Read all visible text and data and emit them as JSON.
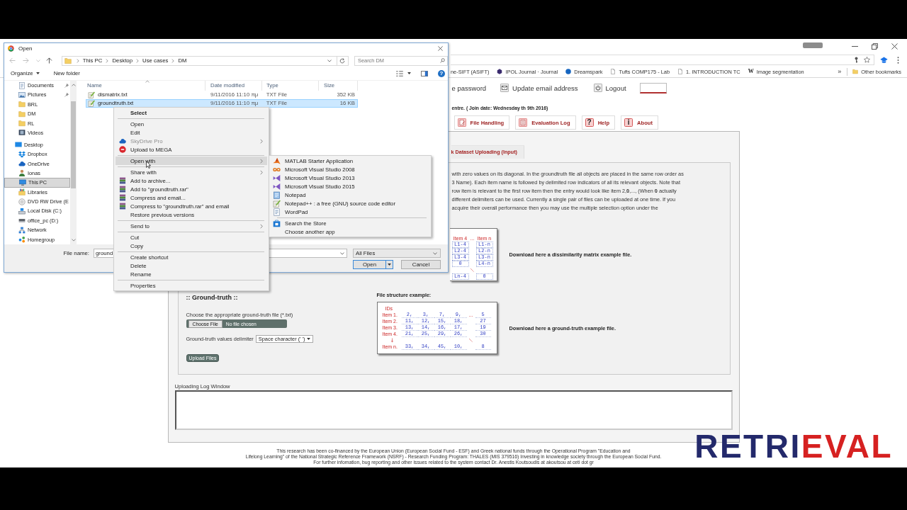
{
  "browser": {
    "bookmarks": [
      {
        "kind": "plain",
        "label": "ne-SIFT (ASIFT)"
      },
      {
        "kind": "hexagon",
        "label": "IPOL Journal · Journal"
      },
      {
        "kind": "disc",
        "label": "Dreamspark"
      },
      {
        "kind": "page",
        "label": "Tufts COMP175 - Lab"
      },
      {
        "kind": "page",
        "label": "1. INTRODUCTION TC"
      },
      {
        "kind": "glyph",
        "glyph": "W",
        "label": "Image segmentation"
      }
    ],
    "more": "»",
    "other_bookmarks": "Other bookmarks"
  },
  "page": {
    "nav": [
      {
        "kind": "plain",
        "label": "e password"
      },
      {
        "kind": "mail",
        "label": "Update email address"
      },
      {
        "kind": "power",
        "label": "Logout"
      }
    ],
    "join_info": "entre. ( Join date: Wednesday th 9th 2016)",
    "tabs": [
      {
        "kind": "file",
        "label": "File Handling"
      },
      {
        "kind": "log",
        "label": "Evaluation Log"
      },
      {
        "kind": "help",
        "glyph": "?",
        "label": "Help"
      },
      {
        "kind": "info",
        "glyph": "i",
        "label": "About"
      }
    ],
    "subtab": "k Dataset Uploading (Input)",
    "description_lines": [
      "with zero values on its diagonal. In the groundtruth file all objects are placed in the same row order as",
      "3 Name). Each item name is followed by delimited row indicators of all its relevant objects. Note that",
      "row item is relevant to the first row item then the entry would look like item 2,**0**,..., (When **0** actually",
      "different delimiters can be used. Currently a single pair of files can be uploaded at one time. If you",
      "acquire their overall performance then you may use the multiple selection option under the"
    ],
    "dissimilarity": {
      "figure": {
        "header": [
          "Item 4",
          "...",
          "Item n"
        ],
        "rows": [
          [
            "L1-4",
            "L1-n"
          ],
          [
            "L2-4",
            "L2-n"
          ],
          [
            "L3-4",
            "L3-n"
          ],
          [
            "0",
            "L4-n"
          ],
          [
            "Ln-4",
            "0"
          ]
        ]
      },
      "download_text": "Download here a dissimilarity matrix example file."
    },
    "ground_truth": {
      "heading": ":: Ground-truth ::",
      "file_label": "Choose the appropriate ground-truth file (*.txt)",
      "choose_button": "Choose File",
      "file_status": "No file chosen",
      "delimiter_label": "Ground-truth values delimiter",
      "delimiter_value": "Space character (' ')",
      "upload_button": "Upload Files",
      "structure_label": "File structure example:",
      "figure": {
        "ids_label": "IDs",
        "rows": [
          {
            "label": "Item 1.",
            "values": [
              "2,",
              "3,",
              "7,",
              "9,"
            ],
            "gap": "...",
            "last": "5"
          },
          {
            "label": "Item 2.",
            "values": [
              "11,",
              "12,",
              "15,",
              "18,"
            ],
            "last": "27"
          },
          {
            "label": "Item 3.",
            "values": [
              "13,",
              "14,",
              "16,",
              "17,"
            ],
            "last": "19"
          },
          {
            "label": "Item 4.",
            "values": [
              "21,",
              "25,",
              "29,",
              "26,"
            ],
            "last": "30"
          },
          {
            "label": "Item n.",
            "values": [
              "33,",
              "34,",
              "45,",
              "10,"
            ],
            "last": "8"
          }
        ]
      },
      "download_text": "Download here a ground-truth example file."
    },
    "log_label": "Uploading Log Window",
    "footer_lines": [
      "This research has been co-financed by the European Union (European Social Fund - ESF) and Greek national funds through the Operational Program \"Education and",
      "Lifelong Learning\" of the National Strategic Reference Framework (NSRF) - Research Funding Program: THALES (MIS 379516) Investing in knowledge society through the European Social Fund.",
      "For further infomation, bug reporting and other issues related to the system contact Dr. Anestis Koutsoudis at akoutsou at ceti dot gr"
    ],
    "logo": [
      "RETRI",
      "EVAL"
    ]
  },
  "dialog": {
    "title": "Open",
    "path": [
      "This PC",
      "Desktop",
      "Use cases",
      "DM"
    ],
    "search_placeholder": "Search DM",
    "organize": "Organize",
    "new_folder": "New folder",
    "help_glyph": "?",
    "quick_access": [
      {
        "label": "Documents",
        "kind": "document",
        "pinned": true,
        "selected": false
      },
      {
        "label": "Pictures",
        "kind": "pictures",
        "pinned": true,
        "selected": false
      },
      {
        "label": "BRL",
        "kind": "folder",
        "pinned": false,
        "selected": false
      },
      {
        "label": "DM",
        "kind": "folder",
        "pinned": false,
        "selected": false
      },
      {
        "label": "RL",
        "kind": "folder",
        "pinned": false,
        "selected": false
      },
      {
        "label": "Videos",
        "kind": "video",
        "pinned": false,
        "selected": false
      }
    ],
    "tree": [
      {
        "label": "Desktop",
        "kind": "desktop",
        "selected": false,
        "children": [
          {
            "label": "Dropbox",
            "kind": "dropbox",
            "selected": false
          },
          {
            "label": "OneDrive",
            "kind": "cloud",
            "selected": false
          },
          {
            "label": "Ionas",
            "kind": "user",
            "selected": false
          },
          {
            "label": "This PC",
            "kind": "pc",
            "selected": true
          },
          {
            "label": "Libraries",
            "kind": "libraries",
            "selected": false
          },
          {
            "label": "DVD RW Drive (E",
            "kind": "dvd",
            "selected": false
          },
          {
            "label": "Local Disk (C:)",
            "kind": "disk",
            "selected": false
          },
          {
            "label": "office_pc (D:)",
            "kind": "drive",
            "selected": false
          },
          {
            "label": "Network",
            "kind": "network",
            "selected": false
          },
          {
            "label": "Homegroup",
            "kind": "homegroup",
            "selected": false
          }
        ]
      }
    ],
    "columns": [
      "Name",
      "Date modified",
      "Type",
      "Size"
    ],
    "files": [
      {
        "name": "dismatrix.txt",
        "date": "9/11/2016 11:10 πμ",
        "type": "TXT File",
        "size": "352 KB",
        "selected": false
      },
      {
        "name": "groundtruth.txt",
        "date": "9/11/2016 11:10 πμ",
        "type": "TXT File",
        "size": "16 KB",
        "selected": true
      }
    ],
    "file_name_label": "File name:",
    "file_name_value": "ground",
    "file_type": "All Files",
    "open_button": "Open",
    "cancel_button": "Cancel"
  },
  "context_menu": {
    "groups": [
      [
        {
          "label": "Select",
          "kind": "default",
          "selected": false,
          "disabled": false,
          "submenu": false
        }
      ],
      [
        {
          "label": "Open",
          "kind": "plain",
          "selected": false,
          "disabled": false,
          "submenu": false
        },
        {
          "label": "Edit",
          "kind": "plain",
          "selected": false,
          "disabled": false,
          "submenu": false
        },
        {
          "label": "SkyDrive Pro",
          "kind": "cloud",
          "selected": false,
          "disabled": true,
          "submenu": true
        },
        {
          "label": "Upload to MEGA",
          "kind": "badge",
          "selected": false,
          "disabled": false,
          "submenu": false
        }
      ],
      [
        {
          "label": "Open with",
          "kind": "plain",
          "selected": true,
          "disabled": false,
          "submenu": true
        }
      ],
      [
        {
          "label": "Share with",
          "kind": "plain",
          "selected": false,
          "disabled": false,
          "submenu": true
        },
        {
          "label": "Add to archive...",
          "kind": "archive",
          "selected": false,
          "disabled": false,
          "submenu": false
        },
        {
          "label": "Add to \"groundtruth.rar\"",
          "kind": "archive",
          "selected": false,
          "disabled": false,
          "submenu": false
        },
        {
          "label": "Compress and email...",
          "kind": "archive",
          "selected": false,
          "disabled": false,
          "submenu": false
        },
        {
          "label": "Compress to \"groundtruth.rar\" and email",
          "kind": "archive",
          "selected": false,
          "disabled": false,
          "submenu": false
        },
        {
          "label": "Restore previous versions",
          "kind": "plain",
          "selected": false,
          "disabled": false,
          "submenu": false
        }
      ],
      [
        {
          "label": "Send to",
          "kind": "plain",
          "selected": false,
          "disabled": false,
          "submenu": true
        }
      ],
      [
        {
          "label": "Cut",
          "kind": "plain",
          "selected": false,
          "disabled": false,
          "submenu": false
        },
        {
          "label": "Copy",
          "kind": "plain",
          "selected": false,
          "disabled": false,
          "submenu": false
        }
      ],
      [
        {
          "label": "Create shortcut",
          "kind": "plain",
          "selected": false,
          "disabled": false,
          "submenu": false
        },
        {
          "label": "Delete",
          "kind": "plain",
          "selected": false,
          "disabled": false,
          "submenu": false
        },
        {
          "label": "Rename",
          "kind": "plain",
          "selected": false,
          "disabled": false,
          "submenu": false
        }
      ],
      [
        {
          "label": "Properties",
          "kind": "plain",
          "selected": false,
          "disabled": false,
          "submenu": false
        }
      ]
    ]
  },
  "submenu": {
    "groups": [
      [
        {
          "label": "MATLAB Starter Application",
          "kind": "cone"
        },
        {
          "label": "Microsoft Visual Studio 2008",
          "kind": "infinity"
        },
        {
          "label": "Microsoft Visual Studio 2013",
          "kind": "bowtie"
        },
        {
          "label": "Microsoft Visual Studio 2015",
          "kind": "bowtie"
        },
        {
          "label": "Notepad",
          "kind": "notepad"
        },
        {
          "label": "Notepad++ : a free (GNU) source code editor",
          "kind": "notepadpp"
        },
        {
          "label": "WordPad",
          "kind": "wordpad"
        }
      ],
      [
        {
          "label": "Search the Store",
          "kind": "store"
        },
        {
          "label": "Choose another app",
          "kind": "none"
        }
      ]
    ]
  }
}
